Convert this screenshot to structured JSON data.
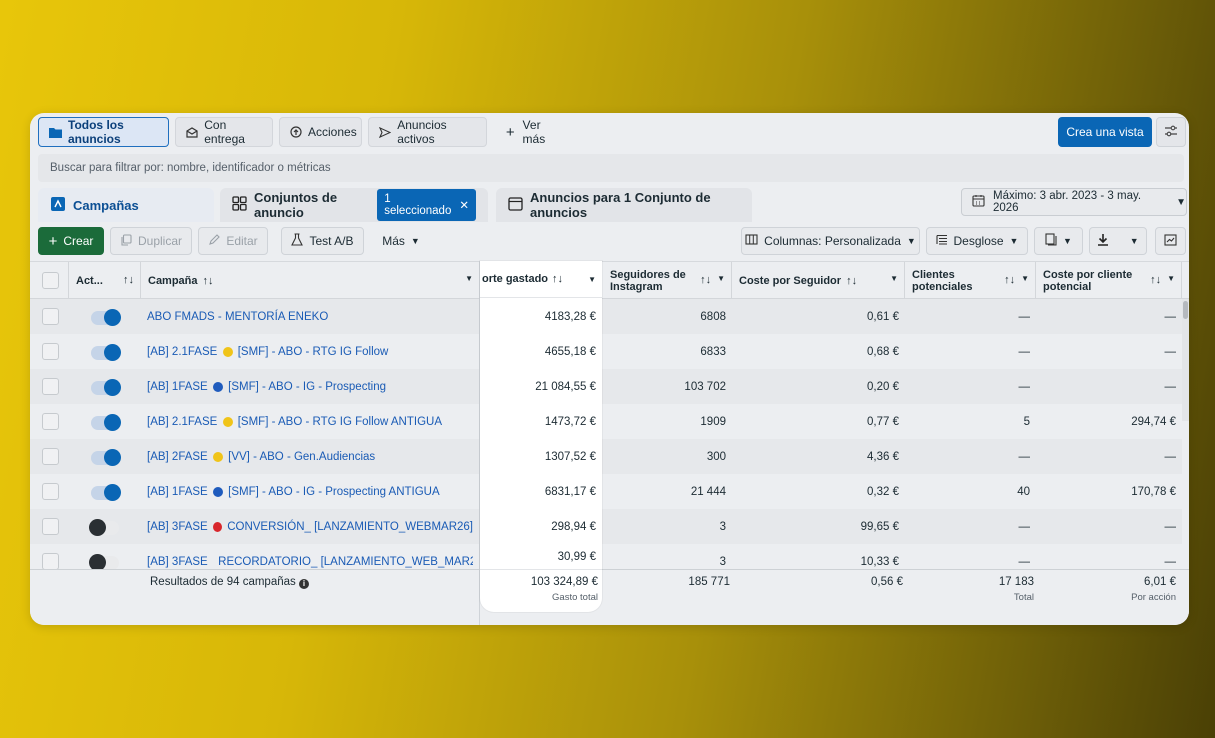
{
  "view_tabs": [
    {
      "label": "Todos los anuncios",
      "icon": "folder-icon"
    },
    {
      "label": "Con entrega",
      "icon": "inbox-icon"
    },
    {
      "label": "Acciones",
      "icon": "upload-circle-icon"
    },
    {
      "label": "Anuncios activos",
      "icon": "send-icon"
    },
    {
      "label": "Ver más",
      "icon": "plus-icon"
    }
  ],
  "create_view_label": "Crea una vista",
  "search": {
    "placeholder": "Buscar para filtrar por: nombre, identificador o métricas"
  },
  "level_tabs": {
    "campaigns": "Campañas",
    "adsets": "Conjuntos de anuncio",
    "selected_badge": "1 seleccionado",
    "ads": "Anuncios para 1 Conjunto de anuncios"
  },
  "date_range": "Máximo: 3 abr. 2023 - 3 may. 2026",
  "toolbar": {
    "create": "Crear",
    "duplicate": "Duplicar",
    "edit": "Editar",
    "ab_test": "Test A/B",
    "more": "Más",
    "columns": "Columnas: Personalizada",
    "breakdown": "Desglose"
  },
  "columns": {
    "activity": "Act...",
    "campaign": "Campaña",
    "spent": "orte gastado",
    "followers_l1": "Seguidores de",
    "followers_l2": "Instagram",
    "cost_per_follower": "Coste por Seguidor",
    "leads_l1": "Clientes",
    "leads_l2": "potenciales",
    "cost_per_lead_l1": "Coste por cliente",
    "cost_per_lead_l2": "potencial"
  },
  "rows": [
    {
      "on": true,
      "name_a": "ABO FMADS - MENTORÍA ENEKO",
      "dot": "",
      "name_b": "",
      "spent": "4183,28 €",
      "followers": "6808",
      "cpf": "0,61 €",
      "leads": "—",
      "cpl": "—"
    },
    {
      "on": true,
      "name_a": "[AB] 2.1FASE",
      "dot": "yellow",
      "name_b": "[SMF] - ABO - RTG IG Follow",
      "spent": "4655,18 €",
      "followers": "6833",
      "cpf": "0,68 €",
      "leads": "—",
      "cpl": "—"
    },
    {
      "on": true,
      "name_a": "[AB] 1FASE",
      "dot": "blue",
      "name_b": "[SMF] - ABO - IG - Prospecting",
      "spent": "21 084,55 €",
      "followers": "103 702",
      "cpf": "0,20 €",
      "leads": "—",
      "cpl": "—"
    },
    {
      "on": true,
      "name_a": "[AB] 2.1FASE",
      "dot": "yellow",
      "name_b": "[SMF] - ABO - RTG IG Follow ANTIGUA",
      "spent": "1473,72 €",
      "followers": "1909",
      "cpf": "0,77 €",
      "leads": "5",
      "cpl": "294,74 €"
    },
    {
      "on": true,
      "name_a": "[AB] 2FASE",
      "dot": "yellow",
      "name_b": "[VV] - ABO - Gen.Audiencias",
      "spent": "1307,52 €",
      "followers": "300",
      "cpf": "4,36 €",
      "leads": "—",
      "cpl": "—"
    },
    {
      "on": true,
      "name_a": "[AB] 1FASE",
      "dot": "blue",
      "name_b": "[SMF] - ABO - IG - Prospecting ANTIGUA",
      "spent": "6831,17 €",
      "followers": "21 444",
      "cpf": "0,32 €",
      "leads": "40",
      "cpl": "170,78 €"
    },
    {
      "on": false,
      "name_a": "[AB] 3FASE",
      "dot": "red",
      "name_b": "CONVERSIÓN_ [LANZAMIENTO_WEBMAR26]",
      "spent": "298,94 €",
      "followers": "3",
      "cpf": "99,65 €",
      "leads": "—",
      "cpl": "—"
    },
    {
      "on": false,
      "name_a": "[AB] 3FASE",
      "dot": "red",
      "name_b": "RECORDATORIO_ [LANZAMIENTO_WEB_MAR2...",
      "spent": "30,99 €",
      "followers": "3",
      "cpf": "10,33 €",
      "leads": "—",
      "cpl": "—"
    }
  ],
  "footer": {
    "results": "Resultados de 94 campañas",
    "spent": "103 324,89 €",
    "spent_sub": "Gasto total",
    "followers": "185 771",
    "cpf": "0,56 €",
    "leads": "17 183",
    "leads_sub": "Total",
    "cpl": "6,01 €",
    "cpl_sub": "Por acción"
  },
  "colors": {
    "accent": "#0a66b5",
    "create": "#1b6b3a",
    "link": "#1a5bb5",
    "yellow_dot": "#f0c419",
    "blue_dot": "#1f5bbd",
    "red_dot": "#d8262b"
  }
}
